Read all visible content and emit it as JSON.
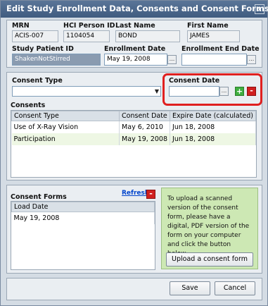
{
  "window": {
    "title": "Edit Study Enrollment Data, Consents and Consent Forms",
    "close_icon": "x"
  },
  "identity": {
    "mrn_label": "MRN",
    "mrn_value": "ACIS-007",
    "hci_label": "HCI Person ID",
    "hci_value": "1104054",
    "last_label": "Last Name",
    "last_value": "BOND",
    "first_label": "First Name",
    "first_value": "JAMES"
  },
  "enrollment": {
    "study_patient_id_label": "Study Patient ID",
    "study_patient_id_value": "ShakenNotStirred",
    "enrollment_date_label": "Enrollment Date",
    "enrollment_date_value": "May 19, 2008",
    "end_date_label": "Enrollment End Date",
    "end_date_value": ""
  },
  "consent_entry": {
    "type_label": "Consent Type",
    "type_value": "",
    "date_label": "Consent Date",
    "date_value": "",
    "add_symbol": "+",
    "remove_symbol": "-",
    "dropdown_icon": "▼",
    "date_picker_icon": "..."
  },
  "consents": {
    "title": "Consents",
    "columns": [
      "Consent Type",
      "Consent Date",
      "Expire Date (calculated)"
    ],
    "rows": [
      [
        "Use of X-Ray Vision",
        "May 6, 2010",
        "Jun 18, 2008"
      ],
      [
        "Participation",
        "May 19, 2008",
        "Jun 18, 2008"
      ]
    ]
  },
  "consent_forms": {
    "title": "Consent Forms",
    "refresh_label": "Refresh",
    "remove_symbol": "-",
    "column": "Load Date",
    "rows": [
      "May 19, 2008"
    ]
  },
  "upload": {
    "instructions": "To upload a scanned version of the consent form, please have a digital, PDF version of the form on your computer and click the button below.",
    "button_label": "Upload a consent form"
  },
  "footer": {
    "save_label": "Save",
    "cancel_label": "Cancel"
  },
  "colors": {
    "title_bar": "#46638a",
    "highlight": "#e02020",
    "upload_bg": "#cde8b4",
    "row_stripe": "#eef7e4"
  }
}
